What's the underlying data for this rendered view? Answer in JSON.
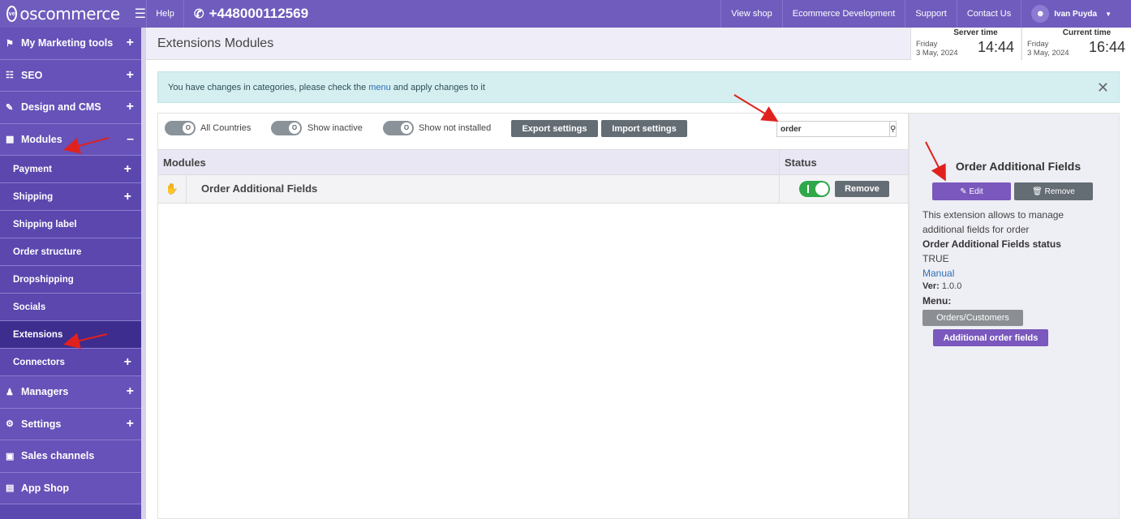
{
  "topbar": {
    "logo_text": "oscommerce",
    "logo_mark": "ve",
    "menu_icon": "hamburger-icon",
    "help": "Help",
    "phone": "+448000112569",
    "links": [
      "View shop",
      "Ecommerce Development",
      "Support",
      "Contact Us"
    ],
    "user_name": "Ivan Puyda"
  },
  "sidebar": {
    "items": [
      {
        "label": "My Marketing tools",
        "icon": "tag-icon",
        "toggle": "+"
      },
      {
        "label": "SEO",
        "icon": "sitemap-icon",
        "toggle": "+"
      },
      {
        "label": "Design and CMS",
        "icon": "pen-icon",
        "toggle": "+"
      },
      {
        "label": "Modules",
        "icon": "puzzle-icon",
        "toggle": "–"
      }
    ],
    "sub_items": [
      {
        "label": "Payment",
        "toggle": "+"
      },
      {
        "label": "Shipping",
        "toggle": "+"
      },
      {
        "label": "Shipping label",
        "toggle": ""
      },
      {
        "label": "Order structure",
        "toggle": ""
      },
      {
        "label": "Dropshipping",
        "toggle": ""
      },
      {
        "label": "Socials",
        "toggle": ""
      },
      {
        "label": "Extensions",
        "toggle": "",
        "active": true
      },
      {
        "label": "Connectors",
        "toggle": "+"
      }
    ],
    "bottom_items": [
      {
        "label": "Managers",
        "icon": "user-icon",
        "toggle": "+"
      },
      {
        "label": "Settings",
        "icon": "gears-icon",
        "toggle": "+"
      },
      {
        "label": "Sales channels",
        "icon": "monitor-icon",
        "toggle": ""
      },
      {
        "label": "App Shop",
        "icon": "shop-icon",
        "toggle": ""
      }
    ]
  },
  "header": {
    "title": "Extensions Modules",
    "server_time": {
      "label": "Server time",
      "day": "Friday",
      "date": "3 May, 2024",
      "time": "14:44"
    },
    "current_time": {
      "label": "Current time",
      "day": "Friday",
      "date": "3 May, 2024",
      "time": "16:44"
    }
  },
  "notice": {
    "before": "You have changes in categories, please check the",
    "link": "menu",
    "after": "and apply changes to it"
  },
  "toolbar": {
    "all_countries": "All Countries",
    "show_inactive": "Show inactive",
    "show_not_installed": "Show not installed",
    "export": "Export settings",
    "import": "Import settings",
    "search_value": "order"
  },
  "table": {
    "headers": [
      "Modules",
      "Status"
    ],
    "rows": [
      {
        "name": "Order Additional Fields",
        "remove": "Remove"
      }
    ]
  },
  "details": {
    "title": "Order Additional Fields",
    "edit": "Edit",
    "remove": "Remove",
    "desc1": "This extension allows to manage",
    "desc2": "additional fields for order",
    "status_label": "Order Additional Fields status",
    "status_value": "TRUE",
    "manual": "Manual",
    "ver_label": "Ver:",
    "ver_value": "1.0.0",
    "menu_label": "Menu:",
    "menu_btn1": "Orders/Customers",
    "menu_btn2": "Additional order fields"
  },
  "colors": {
    "topbar": "#6f5cbd",
    "sidebar": "#5c49b0",
    "accent": "#7a58bd",
    "annotation": "#e0211d"
  }
}
